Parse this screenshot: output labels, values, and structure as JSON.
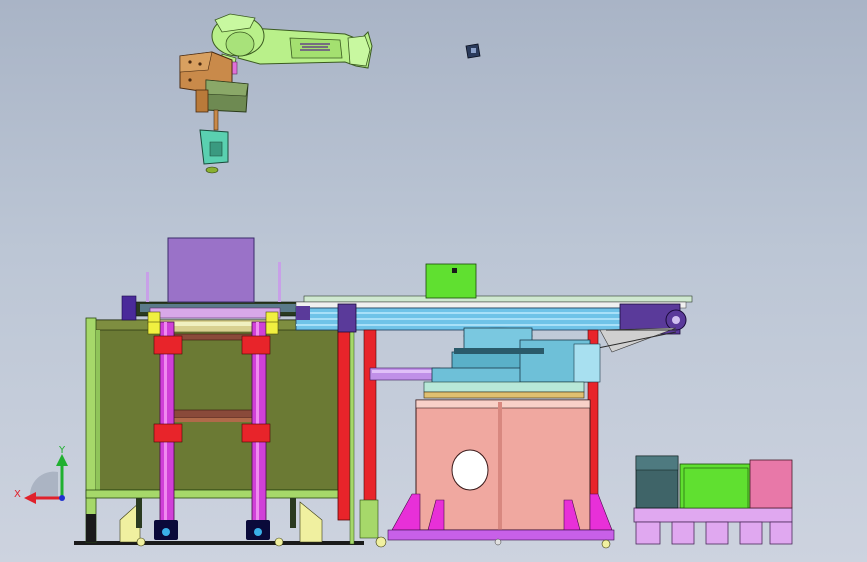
{
  "viewport": {
    "background_top": "#a9b4c6",
    "background_bottom": "#cdd3df"
  },
  "triad": {
    "x_label": "X",
    "y_label": "Y",
    "x_color": "#e0202a",
    "y_color": "#20b030",
    "z_color": "#2030d0"
  },
  "colors": {
    "robot_green": "#b9f08a",
    "robot_orange": "#c98a4a",
    "frame_olive": "#6b7a34",
    "frame_green": "#a6d86a",
    "conveyor_blue": "#6fc3e8",
    "conveyor_purple": "#5a3a9a",
    "column_magenta": "#d040d8",
    "rail_red": "#e8242a",
    "drum_pink": "#f0a8a0",
    "pallet_violet": "#e0a8f0",
    "purple_box": "#9a72c8",
    "lime_box": "#60e030",
    "rose_box": "#e878a8",
    "slate_box": "#3f6468"
  }
}
